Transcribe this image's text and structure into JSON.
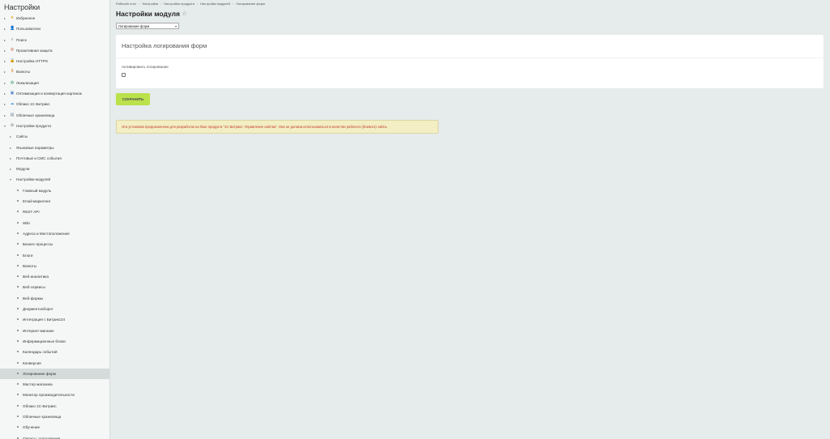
{
  "sidebar": {
    "title": "Настройки",
    "items": [
      {
        "label": "Избранное",
        "level": 0,
        "icon": "star-icon"
      },
      {
        "label": "Пользователи",
        "level": 0,
        "icon": "user-icon"
      },
      {
        "label": "Поиск",
        "level": 0,
        "icon": "search-icon"
      },
      {
        "label": "Проактивная защита",
        "level": 0,
        "icon": "shield-icon"
      },
      {
        "label": "Настройка HTTPS",
        "level": 0,
        "icon": "lock-icon"
      },
      {
        "label": "Валюты",
        "level": 0,
        "icon": "currency-icon"
      },
      {
        "label": "Локализация",
        "level": 0,
        "icon": "globe-icon"
      },
      {
        "label": "Оптимизация и конвертация картинок",
        "level": 0,
        "icon": "image-icon"
      },
      {
        "label": "Облако 1С-Битрикс",
        "level": 0,
        "icon": "cloud-icon"
      },
      {
        "label": "Облачные хранилища",
        "level": 0,
        "icon": "storage-icon"
      },
      {
        "label": "Настройки продукта",
        "level": 0,
        "icon": "settings-icon",
        "expanded": true
      },
      {
        "label": "Сайты",
        "level": 1
      },
      {
        "label": "Языковые параметры",
        "level": 1
      },
      {
        "label": "Почтовые и СМС события",
        "level": 1
      },
      {
        "label": "Модули",
        "level": 1
      },
      {
        "label": "Настройки модулей",
        "level": 1,
        "expanded": true
      },
      {
        "label": "Главный модуль",
        "level": 2
      },
      {
        "label": "Email-маркетинг",
        "level": 2
      },
      {
        "label": "REST API",
        "level": 2
      },
      {
        "label": "Wiki",
        "level": 2
      },
      {
        "label": "Адреса и Местоположения",
        "level": 2
      },
      {
        "label": "Бизнес-процессы",
        "level": 2
      },
      {
        "label": "Блоги",
        "level": 2
      },
      {
        "label": "Валюты",
        "level": 2
      },
      {
        "label": "Веб-аналитика",
        "level": 2
      },
      {
        "label": "Веб-сервисы",
        "level": 2
      },
      {
        "label": "Веб-формы",
        "level": 2
      },
      {
        "label": "Документооборот",
        "level": 2
      },
      {
        "label": "Интеграция с Битрикс24",
        "level": 2
      },
      {
        "label": "Интернет-магазин",
        "level": 2
      },
      {
        "label": "Информационные блоки",
        "level": 2
      },
      {
        "label": "Календарь событий",
        "level": 2
      },
      {
        "label": "Конверсия",
        "level": 2
      },
      {
        "label": "Логирование форм",
        "level": 2,
        "active": true
      },
      {
        "label": "Мастер магазина",
        "level": 2
      },
      {
        "label": "Монитор производительности",
        "level": 2
      },
      {
        "label": "Облако 1С-Битрикс",
        "level": 2
      },
      {
        "label": "Облачные хранилища",
        "level": 2
      },
      {
        "label": "Обучение",
        "level": 2
      },
      {
        "label": "Опросы, голосования",
        "level": 2
      }
    ]
  },
  "breadcrumb": [
    "Рабочий стол",
    "Настройки",
    "Настройки продукта",
    "Настройки модулей",
    "Логирование форм"
  ],
  "breadcrumb_sep": "›",
  "page": {
    "title": "Настройки модуля",
    "star_icon": "☆",
    "module_select_value": "Логирование форм",
    "select_arrow": "▾"
  },
  "panel": {
    "title": "Настройка логирования форм",
    "field_label": "Активировать логирование",
    "checkbox_checked": false
  },
  "save_label": "СОХРАНИТЬ",
  "notice_text": "Эта установка предназначена для разработки на базе продукта \"1С-Битрикс: Управление сайтом\". Она не должна использоваться в качестве рабочего (боевого) сайта.",
  "colors": {
    "save_button": "#bbe14b",
    "notice_bg": "#f3eec3",
    "notice_text": "#c0392b",
    "page_bg": "#e6ebeb"
  }
}
